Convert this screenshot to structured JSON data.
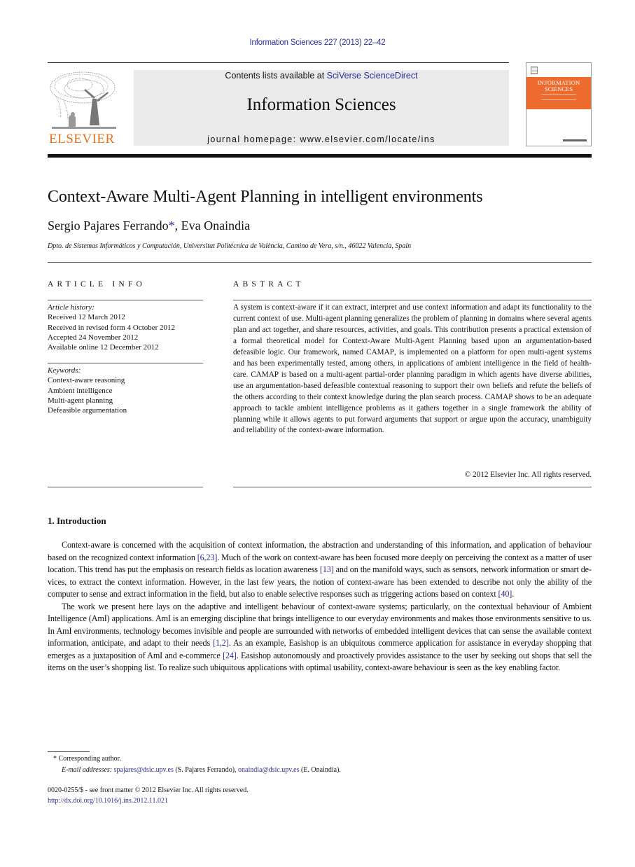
{
  "journal_ref": "Information Sciences 227 (2013) 22–42",
  "header": {
    "publisher_wordmark": "ELSEVIER",
    "contents_prefix": "Contents lists available at ",
    "contents_link": "SciVerse ScienceDirect",
    "journal_title": "Information Sciences",
    "homepage_line": "journal homepage: www.elsevier.com/locate/ins",
    "cover": {
      "title_line1": "INFORMATION",
      "title_line2": "SCIENCES",
      "band_color": "#ee6a2d"
    }
  },
  "article": {
    "title": "Context-Aware Multi-Agent Planning in intelligent environments",
    "authors": [
      {
        "name": "Sergio Pajares Ferrando",
        "marker": "*"
      },
      {
        "name": "Eva Onaindia",
        "marker": ""
      }
    ],
    "author_separator": ", ",
    "affiliation": "Dpto. de Sistemas Informáticos y Computación, Universitat Politècnica de València, Camino de Vera, s/n., 46022 Valencia, Spain"
  },
  "article_info": {
    "heading": "ARTICLE INFO",
    "history_label": "Article history:",
    "history": [
      "Received 12 March 2012",
      "Received in revised form 4 October 2012",
      "Accepted 24 November 2012",
      "Available online 12 December 2012"
    ],
    "keywords_label": "Keywords:",
    "keywords": [
      "Context-aware reasoning",
      "Ambient intelligence",
      "Multi-agent planning",
      "Defeasible argumentation"
    ]
  },
  "abstract": {
    "heading": "ABSTRACT",
    "segments": [
      "A system is context-aware if it can extract, interpret and use context information and adapt its functionality to the current context of use. Multi-agent planning generalizes the prob­lem of planning in domains where several agents plan and act together, and share resources, activities, and goals. This contribution presents a practical extension of a formal theoretical model for Context-Aware Multi-Agent Planning based upon an argumentation-based defeasible logic. Our framework, named ",
      "CAMAP",
      ", is implemented on a platform for open multi-agent systems and has been experimentally tested, among others, in applica­tions of ambient intelligence in the field of health-care. ",
      "CAMAP",
      " is based on a multi-agent partial-order planning paradigm in which agents have diverse abilities, use an argumenta­tion-based defeasible contextual reasoning to support their own beliefs and refute the beliefs of the others according to their context knowledge during the plan search process. ",
      "CAMAP",
      " shows to be an adequate approach to tackle ambient intelligence problems as it gathers together in a single framework the ability of planning while it allows agents to put forward arguments that support or argue upon the accuracy, unambiguity and reliabil­ity of the context-aware information."
    ],
    "copyright": "© 2012 Elsevier Inc. All rights reserved."
  },
  "section": {
    "heading": "1. Introduction",
    "paragraphs": [
      {
        "parts": [
          {
            "text": "Context-aware is concerned with the acquisition of context information, the abstraction and understanding of this infor­mation, and application of behaviour based on the recognized context information "
          },
          {
            "text": "[6,23]",
            "cite": true
          },
          {
            "text": ". Much of the work on context-aware has been focused more deeply on perceiving the context as a matter of user location. This trend has put the emphasis on research fields as location awareness "
          },
          {
            "text": "[13]",
            "cite": true
          },
          {
            "text": " and on the manifold ways, such as sensors, network information or smart de­vices, to extract the context information. However, in the last few years, the notion of context-aware has been extended to describe not only the ability of the computer to sense and extract information in the field, but also to enable selective re­sponses such as triggering actions based on context "
          },
          {
            "text": "[40]",
            "cite": true
          },
          {
            "text": "."
          }
        ]
      },
      {
        "parts": [
          {
            "text": "The work we present here lays on the adaptive and intelligent behaviour of context-aware systems; particularly, on the contextual behaviour of Ambient Intelligence (AmI) applications. AmI is an emerging discipline that brings intelligence to our everyday environments and makes those environments sensitive to us. In AmI environments, technology becomes invis­ible and people are surrounded with networks of embedded intelligent devices that can sense the available context informa­tion, anticipate, and adapt to their needs "
          },
          {
            "text": "[1,2]",
            "cite": true
          },
          {
            "text": ". As an example, Easishop is an ubiquitous commerce application for assistance in everyday shopping that emerges as a juxtaposition of AmI and e-commerce "
          },
          {
            "text": "[24]",
            "cite": true
          },
          {
            "text": ". Easishop autonomously and proactively provides assistance to the user by seeking out shops that sell the items on the user’s shopping list. To realize such ubiquitous applications with optimal usability, context-aware behaviour is seen as the key enabling factor."
          }
        ]
      }
    ]
  },
  "footnotes": {
    "corresponding_marker": "*",
    "corresponding_text": " Corresponding author.",
    "email_label": "E-mail addresses:",
    "emails": [
      {
        "address": "spajares@dsic.upv.es",
        "owner": " (S. Pajares Ferrando), "
      },
      {
        "address": "onaindia@dsic.upv.es",
        "owner": " (E. Onaindia)."
      }
    ]
  },
  "front_matter": {
    "issn_line": "0020-0255/$ - see front matter © 2012 Elsevier Inc. All rights reserved.",
    "doi_link": "http://dx.doi.org/10.1016/j.ins.2012.11.021"
  },
  "colors": {
    "link": "#2a2aa0",
    "elsevier_orange": "#e9711c",
    "banner_gray": "#eaeaea"
  }
}
